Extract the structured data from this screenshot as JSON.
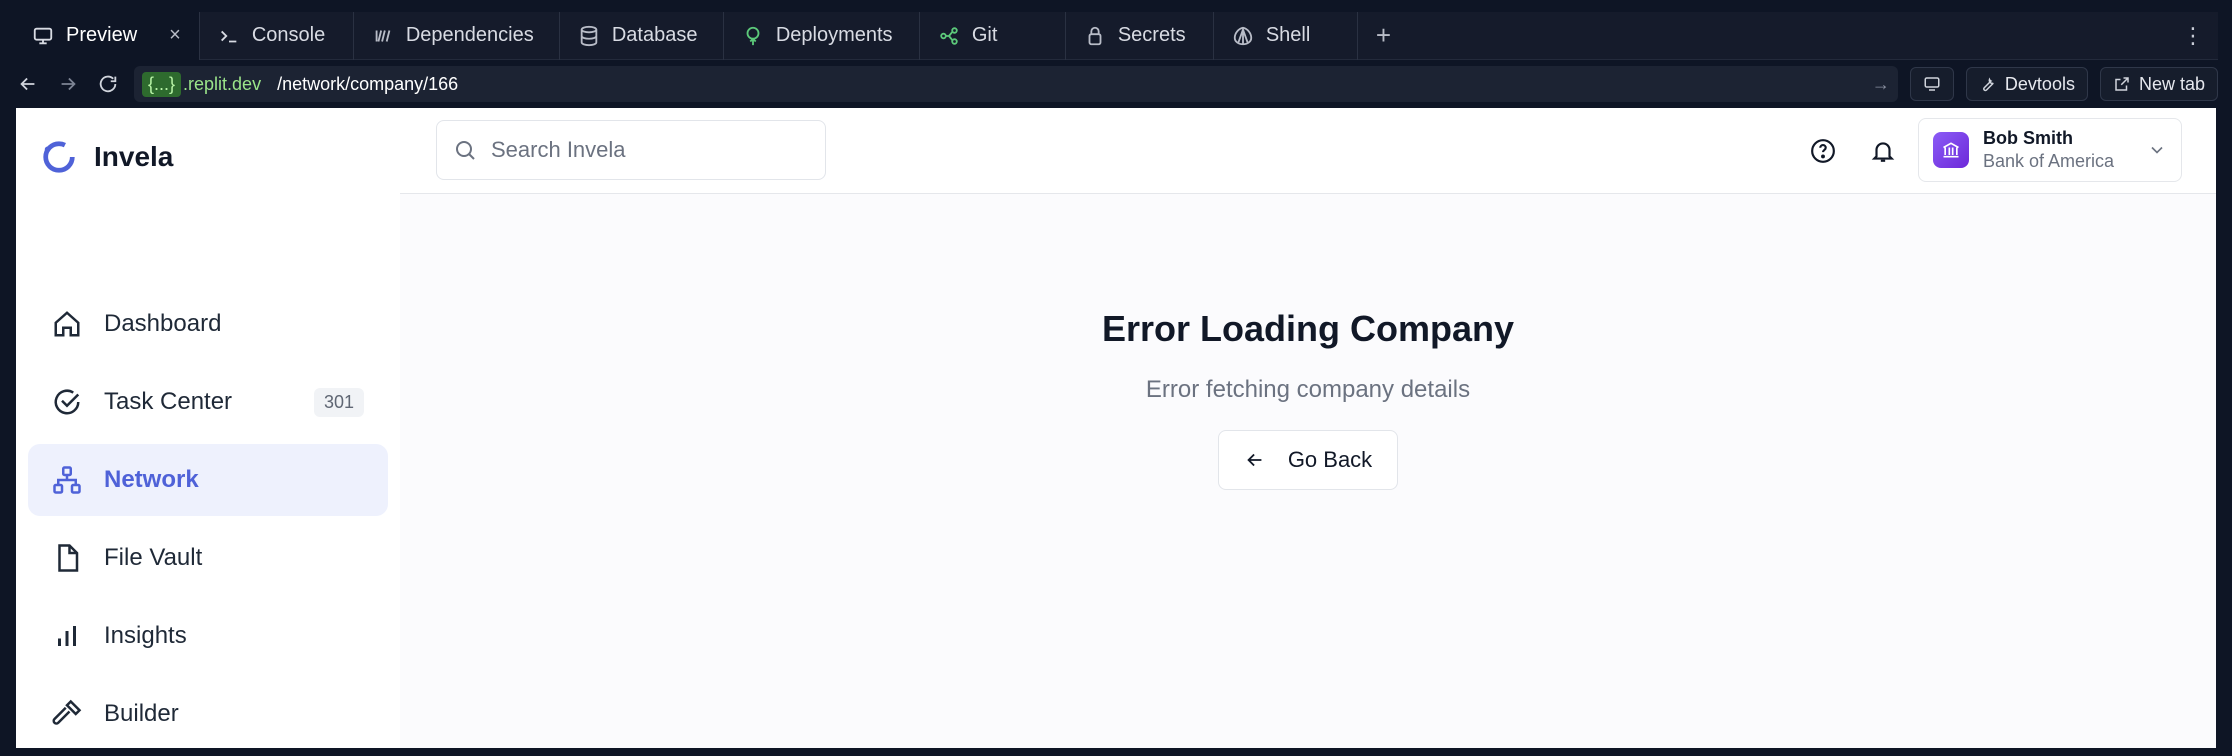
{
  "browser": {
    "tabs": [
      {
        "label": "Preview",
        "icon": "monitor-icon",
        "active": true
      },
      {
        "label": "Console",
        "icon": "terminal-icon"
      },
      {
        "label": "Dependencies",
        "icon": "dependencies-icon"
      },
      {
        "label": "Database",
        "icon": "database-icon"
      },
      {
        "label": "Deployments",
        "icon": "deployments-icon"
      },
      {
        "label": "Git",
        "icon": "git-icon"
      },
      {
        "label": "Secrets",
        "icon": "lock-icon"
      },
      {
        "label": "Shell",
        "icon": "shell-icon"
      }
    ],
    "add_tab": "+",
    "close": "×",
    "url": {
      "braces": "{...}",
      "host": ".replit.dev",
      "path": "/network/company/166"
    },
    "devtools_label": "Devtools",
    "newtab_label": "New tab"
  },
  "app": {
    "brand": "Invela",
    "search_placeholder": "Search Invela",
    "nav": [
      {
        "label": "Dashboard",
        "icon": "home-icon"
      },
      {
        "label": "Task Center",
        "icon": "check-circle-icon",
        "badge": "301"
      },
      {
        "label": "Network",
        "icon": "network-icon",
        "active": true
      },
      {
        "label": "File Vault",
        "icon": "file-icon"
      },
      {
        "label": "Insights",
        "icon": "bar-chart-icon"
      },
      {
        "label": "Builder",
        "icon": "hammer-icon"
      }
    ],
    "user": {
      "name": "Bob Smith",
      "org": "Bank of America"
    },
    "error": {
      "title": "Error Loading Company",
      "message": "Error fetching company details",
      "back_label": "Go Back"
    },
    "colors": {
      "accent": "#4f62d8",
      "active_bg": "#eef1fd",
      "avatar": "#7c3aed"
    }
  }
}
